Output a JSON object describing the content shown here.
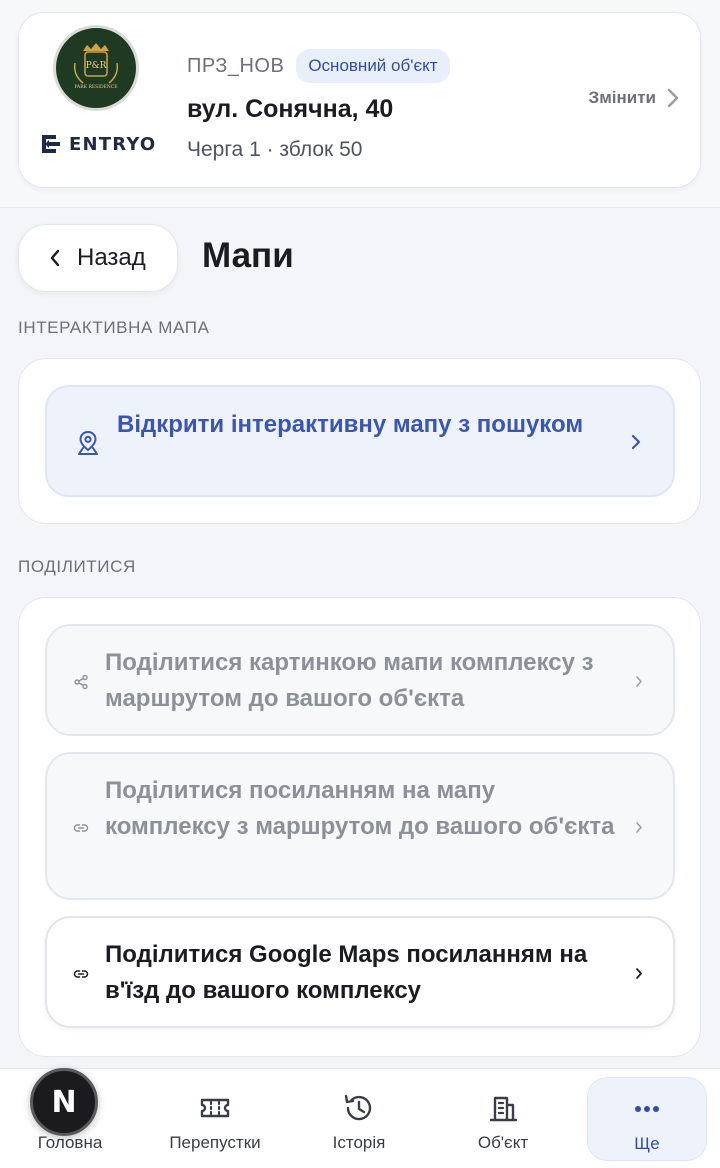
{
  "header": {
    "logo_text": "P&R",
    "logo_subtext": "PARK RESIDENCE",
    "brand": "ENTRYO",
    "property_code": "ПРЗ_НОВ",
    "property_badge": "Основний об'єкт",
    "address": "вул. Сонячна, 40",
    "details": "Черга 1 · зблок 50",
    "change_label": "Змінити"
  },
  "page": {
    "back_label": "Назад",
    "title": "Мапи"
  },
  "interactive": {
    "section_label": "ІНТЕРАКТИВНА МАПА",
    "open_map_label": "Відкрити інтерактивну мапу з пошуком"
  },
  "share": {
    "section_label": "ПОДІЛИТИСЯ",
    "items": [
      {
        "label": "Поділитися картинкою мапи комплексу з маршрутом до вашого об'єкта",
        "icon": "share-icon",
        "enabled": false
      },
      {
        "label": "Поділитися посиланням на мапу комплексу з маршрутом до вашого об'єкта",
        "icon": "link-icon",
        "enabled": false
      },
      {
        "label": "Поділитися Google Maps посиланням на в'їзд до вашого комплексу",
        "icon": "link-icon",
        "enabled": true
      }
    ]
  },
  "nav": {
    "items": [
      {
        "label": "Головна",
        "icon": "home-icon"
      },
      {
        "label": "Перепустки",
        "icon": "ticket-icon"
      },
      {
        "label": "Історія",
        "icon": "history-icon"
      },
      {
        "label": "Об'єкт",
        "icon": "building-icon"
      },
      {
        "label": "Ще",
        "icon": "more-icon"
      }
    ],
    "active_index": 4,
    "overlay_badge": "N"
  },
  "colors": {
    "accent": "#3a56b0",
    "badge_bg": "#e9eefb",
    "logo_bg": "#1f3a22"
  }
}
